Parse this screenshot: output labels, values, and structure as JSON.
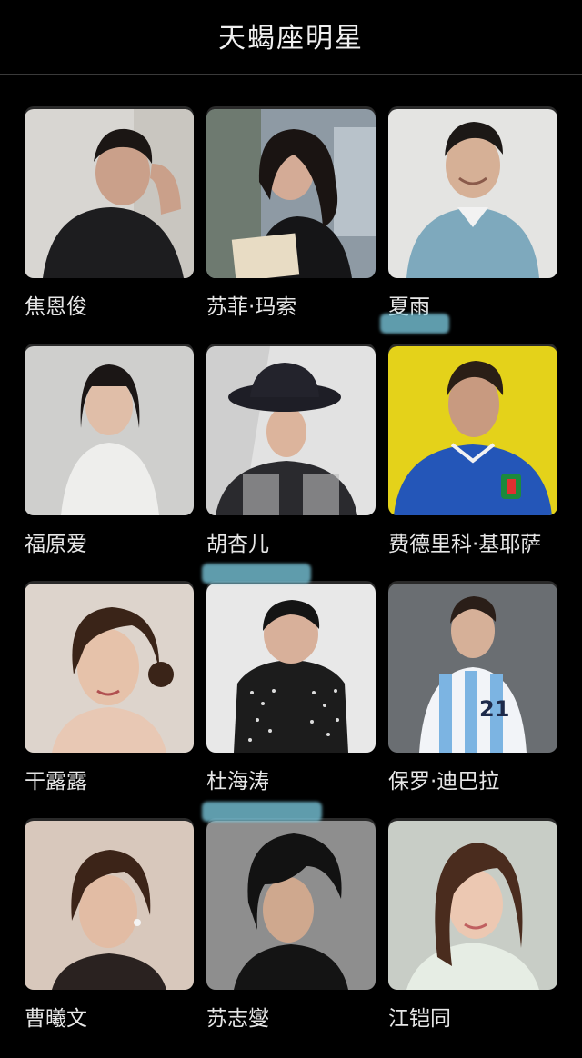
{
  "header": {
    "title": "天蝎座明星"
  },
  "colors": {
    "background": "#000000",
    "text": "#e6e6e6",
    "divider": "#3a3a3a"
  },
  "celebrities": [
    {
      "name": "焦恩俊"
    },
    {
      "name": "苏菲·玛索"
    },
    {
      "name": "夏雨"
    },
    {
      "name": "福原爱"
    },
    {
      "name": "胡杏儿"
    },
    {
      "name": "费德里科·基耶萨"
    },
    {
      "name": "干露露"
    },
    {
      "name": "杜海涛"
    },
    {
      "name": "保罗·迪巴拉"
    },
    {
      "name": "曹曦文"
    },
    {
      "name": "苏志燮"
    },
    {
      "name": "江铠同"
    }
  ]
}
